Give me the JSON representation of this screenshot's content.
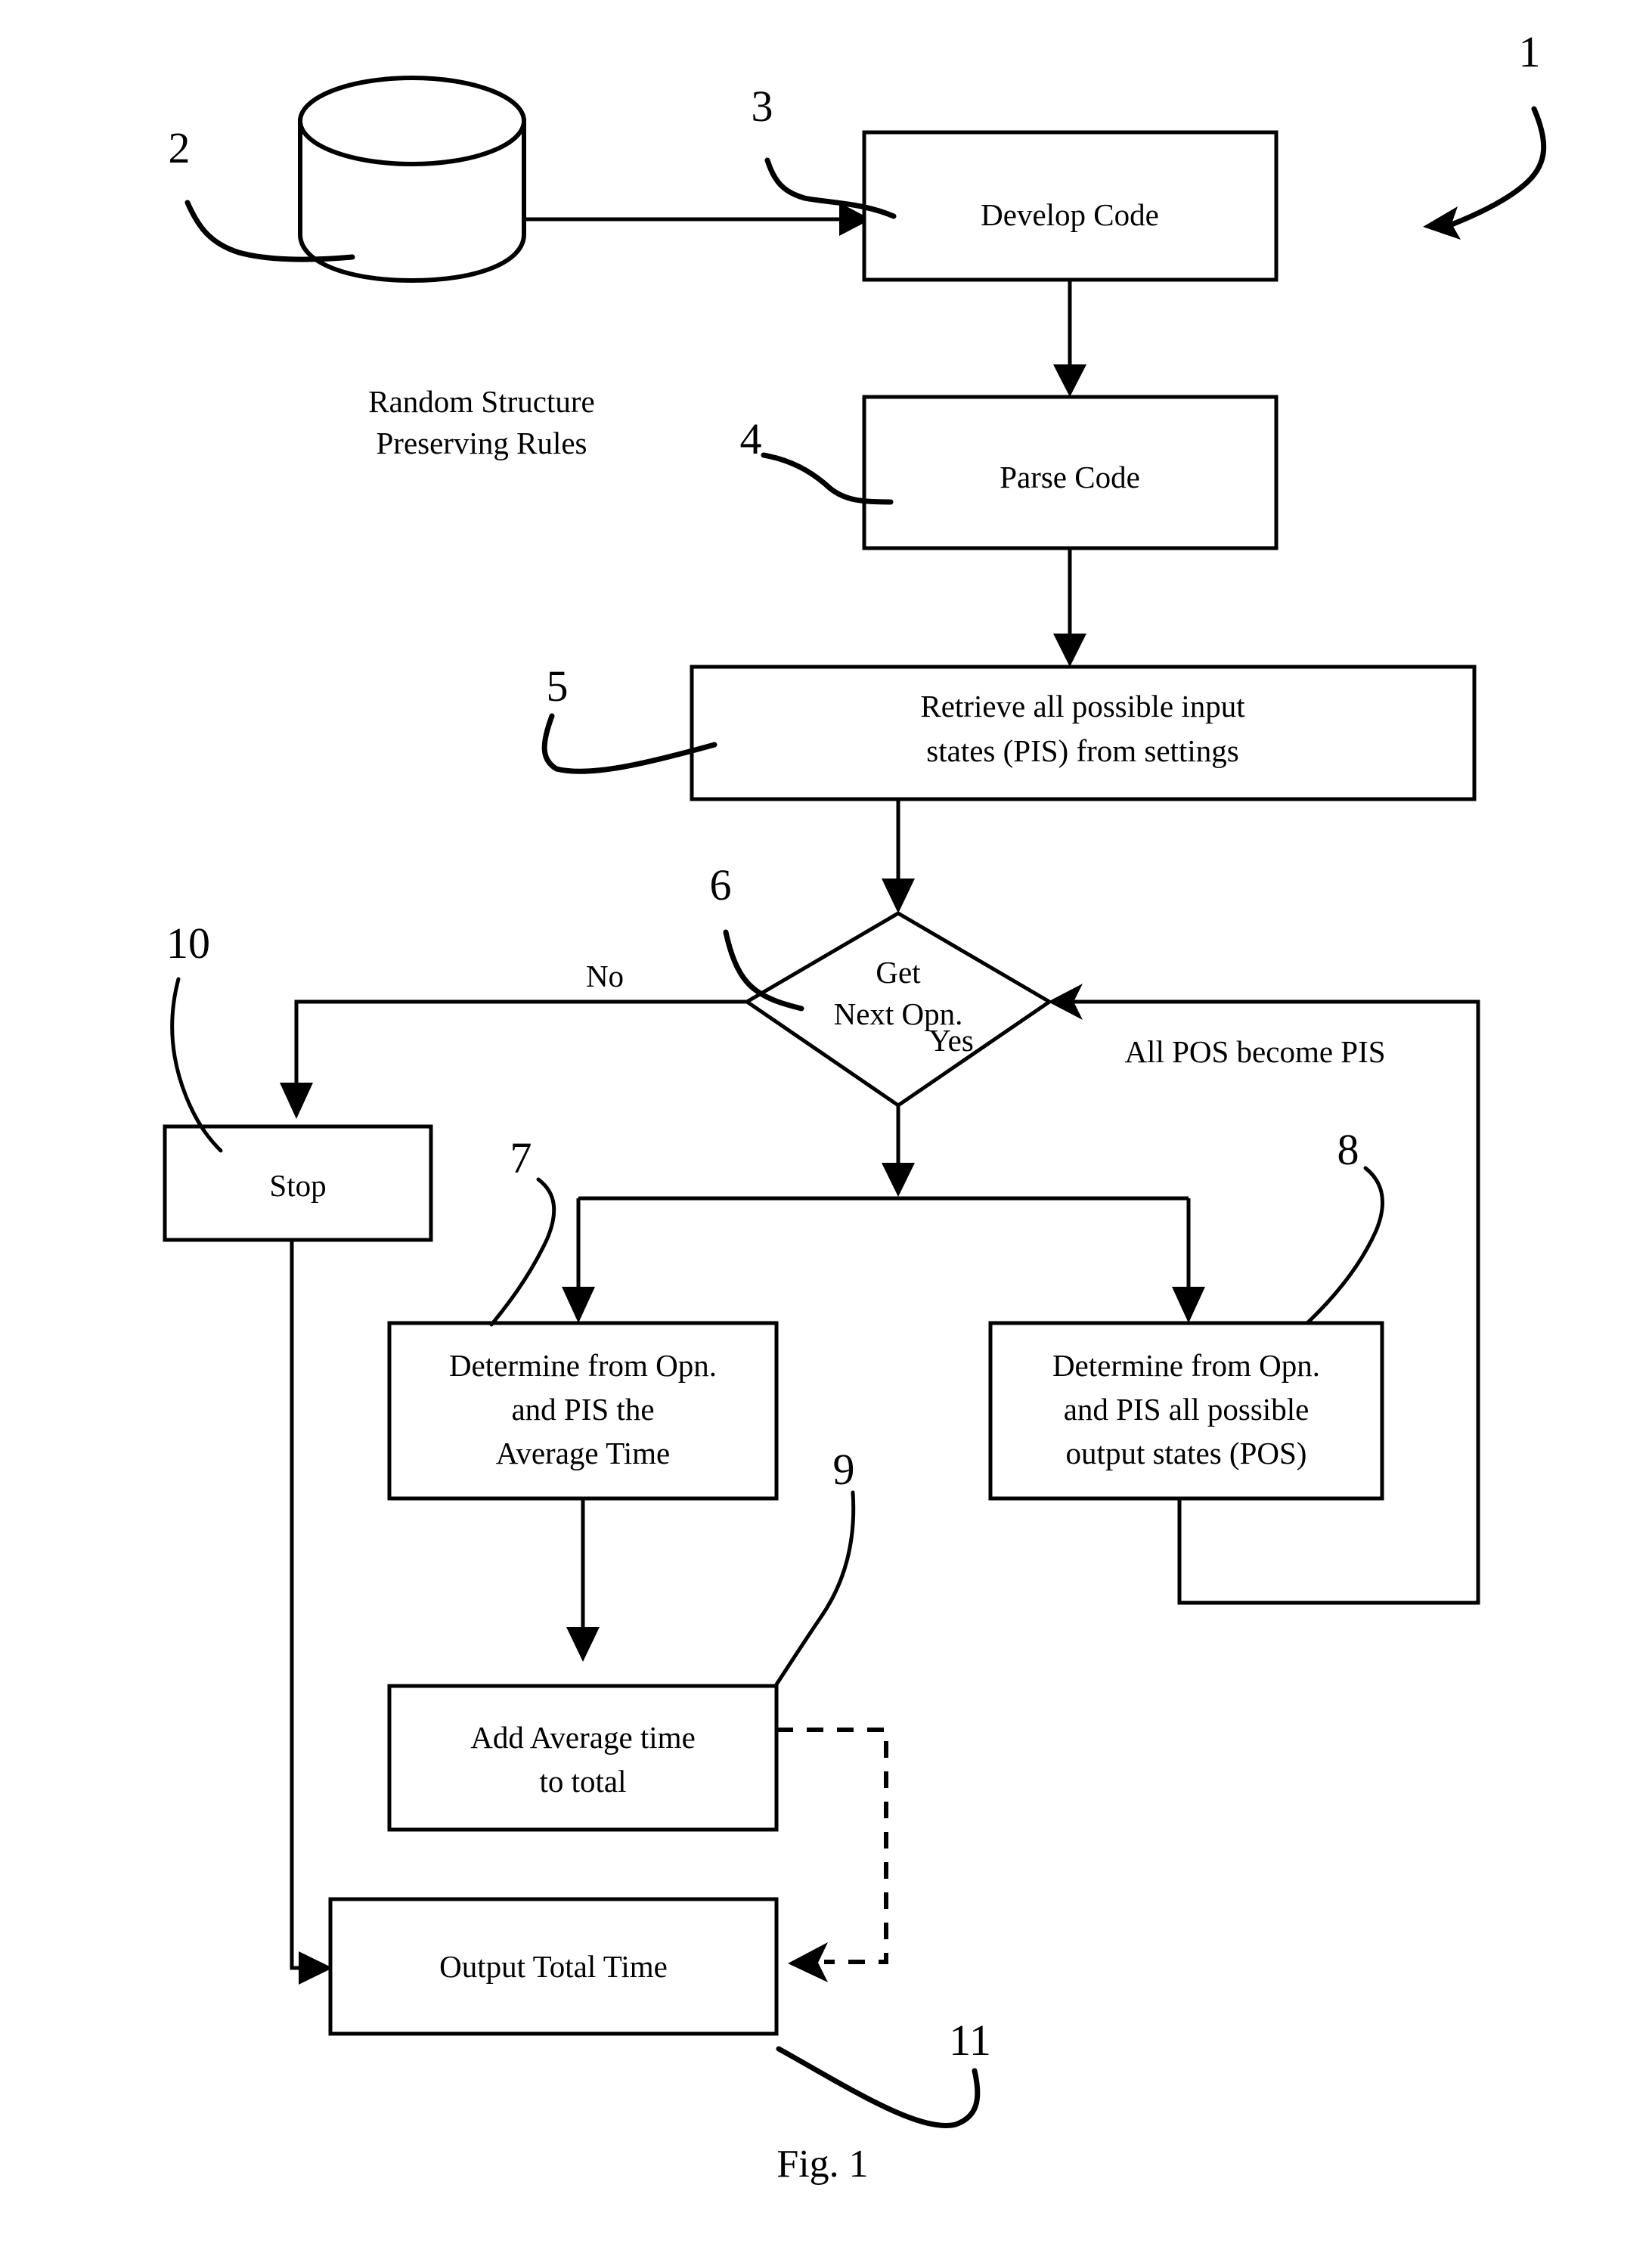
{
  "figure": {
    "caption": "Fig. 1",
    "top_reference": "1"
  },
  "nodes": {
    "datastore": {
      "ref": "2",
      "caption_line1": "Random Structure",
      "caption_line2": "Preserving Rules"
    },
    "develop_code": {
      "ref": "3",
      "label": "Develop Code"
    },
    "parse_code": {
      "ref": "4",
      "label": "Parse Code"
    },
    "retrieve_pis": {
      "ref": "5",
      "line1": "Retrieve all possible input",
      "line2": "states (PIS) from settings"
    },
    "decision": {
      "ref": "6",
      "line1": "Get",
      "line2": "Next Opn."
    },
    "determine_avg_time": {
      "ref": "7",
      "line1": "Determine from Opn.",
      "line2": "and PIS the",
      "line3": "Average Time"
    },
    "determine_pos": {
      "ref": "8",
      "line1": "Determine from Opn.",
      "line2": "and PIS all possible",
      "line3": "output states (POS)"
    },
    "add_average": {
      "ref": "9",
      "line1": "Add Average time",
      "line2": "to total"
    },
    "stop": {
      "ref": "10",
      "label": "Stop"
    },
    "output_total": {
      "ref": "11",
      "label": "Output Total Time"
    }
  },
  "edges": {
    "no_label": "No",
    "yes_label": "Yes",
    "loop_label": "All POS become PIS"
  }
}
